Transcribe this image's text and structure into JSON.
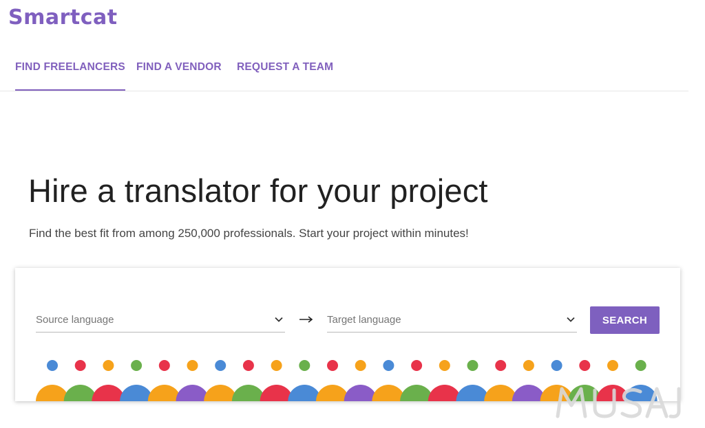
{
  "brand": {
    "name": "Smartcat",
    "color": "#7f5fbf"
  },
  "nav": {
    "tabs": [
      {
        "label": "FIND FREELANCERS",
        "active": true
      },
      {
        "label": "FIND A VENDOR",
        "active": false
      },
      {
        "label": "REQUEST A TEAM",
        "active": false
      }
    ]
  },
  "hero": {
    "title": "Hire a translator for your project",
    "subtitle": "Find the best fit from among 250,000 professionals. Start your project within minutes!"
  },
  "search": {
    "source_placeholder": "Source language",
    "target_placeholder": "Target language",
    "button_label": "SEARCH",
    "button_color": "#7e60bf"
  },
  "illustration": {
    "people_colors": [
      "#f6a21b",
      "#6ab04c",
      "#e8334a",
      "#4a8ad6",
      "#f6a21b",
      "#8a5cc7",
      "#f6a21b",
      "#6ab04c",
      "#e8334a",
      "#4a8ad6",
      "#f6a21b",
      "#8a5cc7",
      "#f6a21b",
      "#6ab04c",
      "#e8334a",
      "#4a8ad6",
      "#f6a21b",
      "#8a5cc7",
      "#f6a21b",
      "#6ab04c",
      "#e8334a",
      "#4a8ad6"
    ],
    "head_colors": [
      "#4a8ad6",
      "#e8334a",
      "#f6a21b",
      "#6ab04c",
      "#e8334a",
      "#f6a21b",
      "#4a8ad6",
      "#e8334a",
      "#f6a21b",
      "#6ab04c",
      "#e8334a",
      "#f6a21b",
      "#4a8ad6",
      "#e8334a",
      "#f6a21b",
      "#6ab04c",
      "#e8334a",
      "#f6a21b",
      "#4a8ad6",
      "#e8334a",
      "#f6a21b",
      "#6ab04c"
    ]
  },
  "watermark": {
    "text": "MUSAJ"
  }
}
